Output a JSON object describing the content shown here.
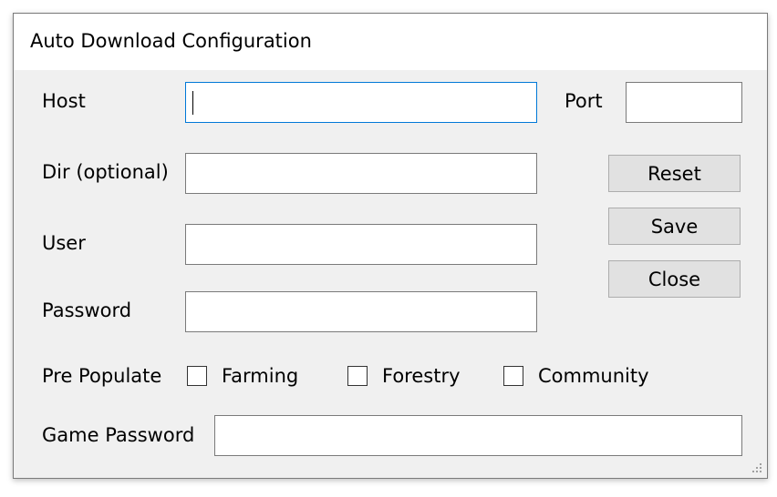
{
  "window": {
    "title": "Auto Download Configuration"
  },
  "labels": {
    "host": "Host",
    "port": "Port",
    "dir": "Dir (optional)",
    "user": "User",
    "password": "Password",
    "pre_populate": "Pre Populate",
    "game_password": "Game Password"
  },
  "fields": {
    "host": "",
    "port": "",
    "dir": "",
    "user": "",
    "password": "",
    "game_password": ""
  },
  "buttons": {
    "reset": "Reset",
    "save": "Save",
    "close": "Close"
  },
  "checkboxes": [
    {
      "label": "Farming",
      "checked": false
    },
    {
      "label": "Forestry",
      "checked": false
    },
    {
      "label": "Community",
      "checked": false
    }
  ],
  "colors": {
    "focus_border": "#0078d7",
    "button_bg": "#e1e1e1",
    "window_bg": "#f0f0f0"
  }
}
